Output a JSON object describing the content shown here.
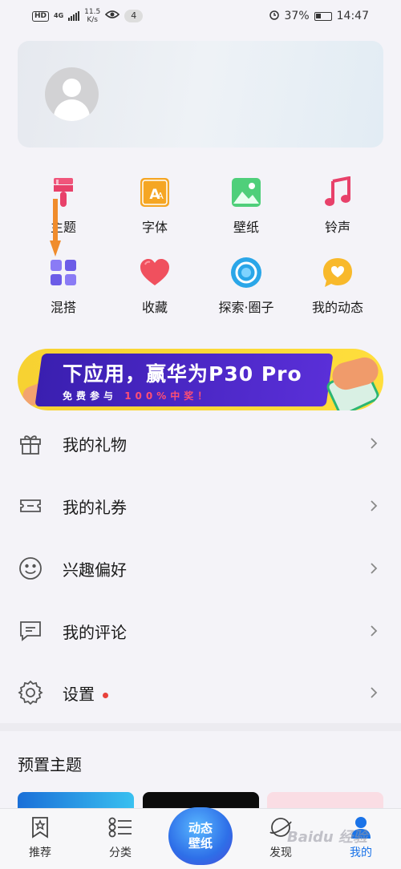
{
  "status_bar": {
    "hd": "HD",
    "network": "4G",
    "speed_value": "11.5",
    "speed_unit": "K/s",
    "badge": "4",
    "battery": "37%",
    "time": "14:47"
  },
  "grid": [
    {
      "label": "主题",
      "icon": "paint-brush-icon",
      "color": "#e8416a"
    },
    {
      "label": "字体",
      "icon": "font-icon",
      "color": "#f5a623"
    },
    {
      "label": "壁纸",
      "icon": "wallpaper-icon",
      "color": "#3cbf6a"
    },
    {
      "label": "铃声",
      "icon": "music-note-icon",
      "color": "#e8416a"
    },
    {
      "label": "混搭",
      "icon": "grid-icon",
      "color": "#7b6cf0"
    },
    {
      "label": "收藏",
      "icon": "heart-icon",
      "color": "#ef4a5a"
    },
    {
      "label": "探索·圈子",
      "icon": "circle-icon",
      "color": "#2aa6e8"
    },
    {
      "label": "我的动态",
      "icon": "chat-heart-icon",
      "color": "#f5b82a"
    }
  ],
  "banner": {
    "title": "下应用，赢华为P30 Pro",
    "sub_white": "免费参与",
    "sub_red": "100%中奖！"
  },
  "menu": [
    {
      "label": "我的礼物",
      "icon": "gift-icon"
    },
    {
      "label": "我的礼券",
      "icon": "ticket-icon"
    },
    {
      "label": "兴趣偏好",
      "icon": "smile-icon"
    },
    {
      "label": "我的评论",
      "icon": "comment-icon"
    },
    {
      "label": "设置",
      "icon": "settings-gear-icon",
      "has_dot": true
    }
  ],
  "section": {
    "title": "预置主题"
  },
  "bottom_nav": [
    {
      "label": "推荐",
      "icon": "bookmark-star-icon"
    },
    {
      "label": "分类",
      "icon": "list-icon"
    },
    {
      "label_line1": "动态",
      "label_line2": "壁纸",
      "icon": "live-wallpaper-icon"
    },
    {
      "label": "发现",
      "icon": "planet-icon"
    },
    {
      "label": "我的",
      "icon": "person-icon",
      "active": true
    }
  ],
  "watermark": "Baidu 经验",
  "colors": {
    "accent": "#1a73e8",
    "arrow": "#f08c2c",
    "dot": "#e8413b"
  }
}
